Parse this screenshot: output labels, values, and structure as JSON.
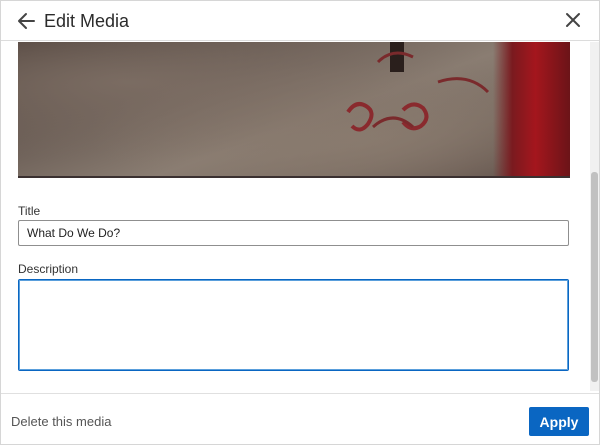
{
  "header": {
    "title": "Edit Media",
    "back_icon": "arrow-left-icon",
    "close_icon": "close-icon"
  },
  "form": {
    "title_label": "Title",
    "title_value": "What Do We Do?",
    "description_label": "Description",
    "description_value": ""
  },
  "footer": {
    "delete_label": "Delete this media",
    "apply_label": "Apply"
  },
  "colors": {
    "accent": "#0a66c2"
  }
}
